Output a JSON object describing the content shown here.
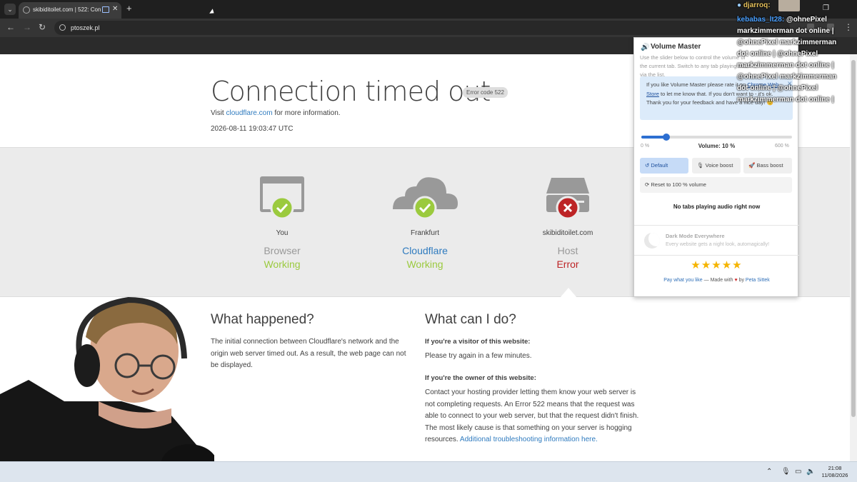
{
  "browser": {
    "tab_title": "skibiditoilet.com | 522: Conn",
    "new_tab_label": "+",
    "address": "ptoszek.pl",
    "window_controls": [
      "—",
      "❐",
      "✕"
    ]
  },
  "page": {
    "title": "Connection timed out",
    "error_badge": "Error code 522",
    "visit_prefix": "Visit",
    "visit_link": "cloudflare.com",
    "visit_suffix": "for more information.",
    "timestamp": "2026-08-11 19:03:47 UTC",
    "nodes": [
      {
        "location": "You",
        "label": "Browser",
        "status": "Working",
        "state": "ok",
        "status_color": "#9bca3e"
      },
      {
        "location": "Frankfurt",
        "label": "Cloudflare",
        "status": "Working",
        "state": "ok",
        "status_color": "#9bca3e"
      },
      {
        "location": "skibiditoilet.com",
        "label": "Host",
        "status": "Error",
        "state": "error",
        "status_color": "#bd2426"
      }
    ],
    "what_happened": {
      "title": "What happened?",
      "text": "The initial connection between Cloudflare's network and the origin web server timed out. As a result, the web page can not be displayed."
    },
    "what_can_i_do": {
      "title": "What can I do?",
      "visitor_heading": "If you're a visitor of this website:",
      "visitor_text": "Please try again in a few minutes.",
      "owner_heading": "If you're the owner of this website:",
      "owner_text": "Contact your hosting provider letting them know your web server is not completing requests. An Error 522 means that the request was able to connect to your web server, but that the request didn't finish. The most likely cause is that something on your server is hogging resources.",
      "owner_link": "Additional troubleshooting information here."
    }
  },
  "volume_master": {
    "title": "Volume Master",
    "description": "Use the slider below to control the volume of the current tab. Switch to any tab playing audio via the list.",
    "rate_text_1": "If you like Volume Master please rate it on",
    "rate_link": "Chrome Web Store",
    "rate_text_2": "to let me know that. If you don't want to - it's ok. Thank you for your feedback and have a nice day! 😊",
    "close": "✕",
    "slider_min_label": "0 %",
    "slider_max_label": "600 %",
    "volume_label": "Volume: 10 %",
    "volume_fraction": 0.1667,
    "buttons": {
      "default": "Default",
      "voice_boost": "Voice boost",
      "bass_boost": "Bass boost"
    },
    "reset_label": "Reset to 100 % volume",
    "no_audio": "No tabs playing audio right now",
    "dark_mode_title": "Dark Mode Everywhere",
    "dark_mode_sub": "Every website gets a night look, automagically!",
    "stars": "★★★★★",
    "footer_link_1": "Pay what you like",
    "footer_made": "— Made with",
    "footer_heart": "♥",
    "footer_by": "by",
    "footer_author": "Peta Sittek"
  },
  "chat": {
    "line1_user": "djarroq:",
    "line2_user": "kebabas_lt28:",
    "line2_text": "@ohnePixel",
    "line3_text": "markzimmerman dot online |",
    "line4_text": "@ohnePixel markzimmerman",
    "line5_text": "dot online | @ohnePixel",
    "line6_text": "markzimmerman dot online |",
    "line7_text": "@ohnePixel markzimmerman",
    "line8_text": "dot online | @ohnePixel",
    "line9_text": "markzimmerman dot online |"
  },
  "taskbar": {
    "time": "21:08",
    "date": "11/08/2026"
  },
  "colors": {
    "link": "#2f7bbf",
    "ok": "#9bca3e",
    "error": "#bd2426",
    "accent": "#2d6fd1"
  }
}
